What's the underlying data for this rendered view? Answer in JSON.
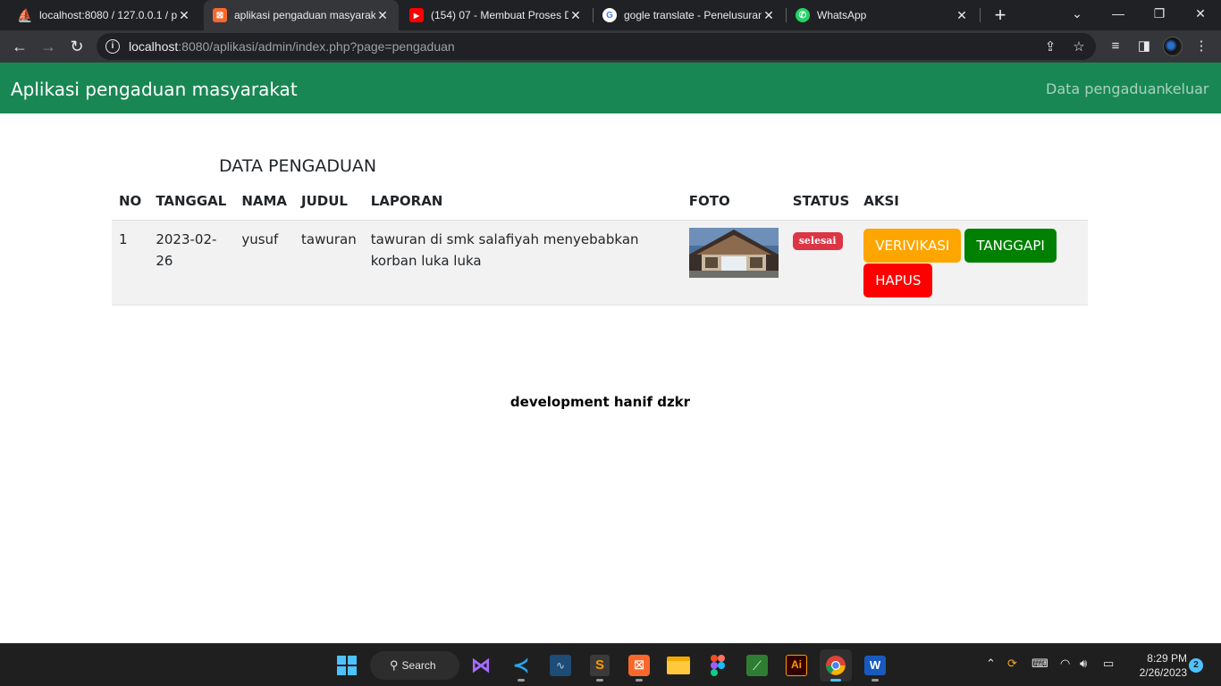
{
  "browser": {
    "tabs": [
      {
        "title": "localhost:8080 / 127.0.0.1 / p",
        "active": false,
        "favicon": "phpmyadmin-icon"
      },
      {
        "title": "aplikasi pengaduan masyarak",
        "active": true,
        "favicon": "xampp-icon"
      },
      {
        "title": "(154) 07 - Membuat Proses D",
        "active": false,
        "favicon": "youtube-icon"
      },
      {
        "title": "gogle translate - Penelusuran",
        "active": false,
        "favicon": "google-icon"
      },
      {
        "title": "WhatsApp",
        "active": false,
        "favicon": "whatsapp-icon"
      }
    ],
    "url_host": "localhost",
    "url_rest": ":8080/aplikasi/admin/index.php?page=pengaduan"
  },
  "app": {
    "brand": "Aplikasi pengaduan masyarakat",
    "nav": {
      "data": "Data pengaduan",
      "logout": "keluar"
    },
    "heading": "DATA PENGADUAN",
    "table": {
      "headers": {
        "no": "NO",
        "date": "TANGGAL",
        "name": "NAMA",
        "title": "JUDUL",
        "report": "LAPORAN",
        "photo": "FOTO",
        "status": "STATUS",
        "action": "AKSI"
      },
      "rows": [
        {
          "no": "1",
          "date_line1": "2023-02-",
          "date_line2": "26",
          "name": "yusuf",
          "title": "tawuran",
          "report": "tawuran di smk salafiyah menyebabkan korban luka luka",
          "status": "selesai"
        }
      ]
    },
    "actions": {
      "verify": "VERIVIKASI",
      "reply": "TANGGAPI",
      "delete": "HAPUS"
    },
    "footer": "development hanif dzkr"
  },
  "taskbar": {
    "search": "Search",
    "clock_time": "8:29 PM",
    "clock_date": "2/26/2023",
    "notifications": "2"
  },
  "colors": {
    "appbar": "#198754",
    "verify": "#ffa500",
    "reply": "#008000",
    "delete": "#ff0000",
    "badge": "#dc3545"
  }
}
